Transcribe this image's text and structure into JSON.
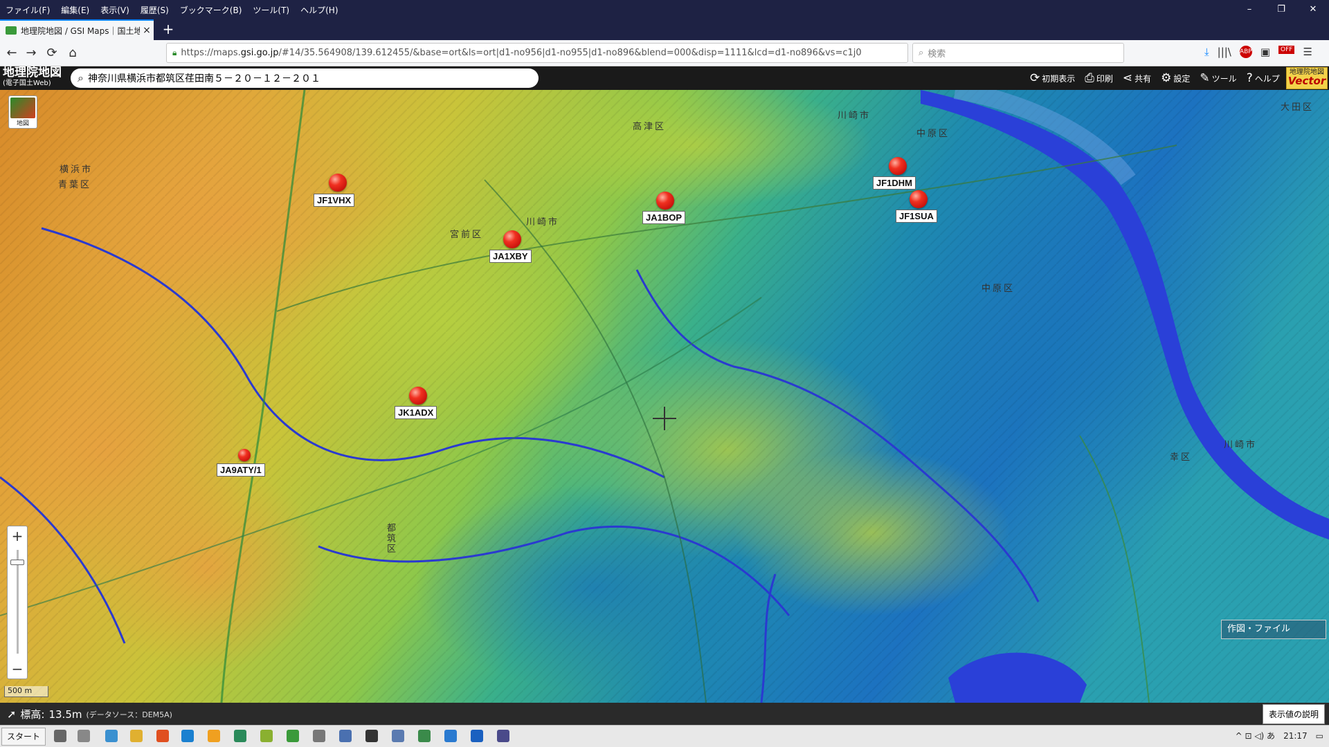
{
  "menu": [
    "ファイル(F)",
    "編集(E)",
    "表示(V)",
    "履歴(S)",
    "ブックマーク(B)",
    "ツール(T)",
    "ヘルプ(H)"
  ],
  "window_controls": [
    "–",
    "❐",
    "✕"
  ],
  "tab": {
    "title": "地理院地図 / GSI Maps｜国土地",
    "close": "×"
  },
  "newtab": "+",
  "nav": {
    "back": "←",
    "forward": "→",
    "reload": "⟳",
    "home": "⌂"
  },
  "url": {
    "scheme": "https://maps.",
    "domain": "gsi.go.jp",
    "rest": "/#14/35.564908/139.612455/&base=ort&ls=ort|d1-no956|d1-no955|d1-no896&blend=000&disp=1111&lcd=d1-no896&vs=c1j0"
  },
  "url_icons": "⋯  ♡  ☆",
  "search": {
    "placeholder": "検索",
    "icon": "search-icon"
  },
  "right_nav": [
    "⤓",
    "|||\\",
    "▣",
    "☰"
  ],
  "abp_label": "ABP",
  "off_badge": "OFF",
  "gsi": {
    "logo_line1": "地理院地図",
    "logo_line2": "(電子国土Web)",
    "address": "神奈川県横浜市都筑区荏田南５－２０－１２－２０１",
    "tools": [
      {
        "icon": "refresh-icon",
        "glyph": "⟳",
        "label": "初期表示"
      },
      {
        "icon": "print-icon",
        "glyph": "⎙",
        "label": "印刷"
      },
      {
        "icon": "share-icon",
        "glyph": "⋖",
        "label": "共有"
      },
      {
        "icon": "gear-icon",
        "glyph": "⚙",
        "label": "設定"
      },
      {
        "icon": "tool-icon",
        "glyph": "✎",
        "label": "ツール"
      },
      {
        "icon": "help-icon",
        "glyph": "?",
        "label": "ヘルプ"
      }
    ],
    "vector_logo_line1": "地理院地図",
    "vector_logo_line2": "Vector"
  },
  "map": {
    "layer_button_label": "地図",
    "zoom_in": "+",
    "zoom_out": "−",
    "scale_label": "500 m",
    "draw_file_button": "作図・ファイル",
    "place_labels": [
      {
        "text": "高津区"
      },
      {
        "text": "川崎市"
      },
      {
        "text": "中原区"
      },
      {
        "text": "大田区"
      },
      {
        "text": "横浜市"
      },
      {
        "text": "青葉区"
      },
      {
        "text": "宮前区"
      },
      {
        "text": "川崎市"
      },
      {
        "text": "中原区"
      },
      {
        "text": "都筑区"
      },
      {
        "text": "川崎市"
      },
      {
        "text": "幸区"
      }
    ],
    "markers": [
      {
        "label": "JF1VHX"
      },
      {
        "label": "JA1BOP"
      },
      {
        "label": "JA1XBY"
      },
      {
        "label": "JF1DHM"
      },
      {
        "label": "JF1SUA"
      },
      {
        "label": "JK1ADX"
      },
      {
        "label": "JA9ATY/1"
      }
    ]
  },
  "status": {
    "elevation_label": "標高:",
    "elevation_value": "13.5m",
    "source": "(データソース：DEM5A)",
    "legend_button": "表示値の説明"
  },
  "taskbar": {
    "start": "スタート",
    "time": "21:17",
    "tray": "^  ⊡  ◁)  あ"
  }
}
